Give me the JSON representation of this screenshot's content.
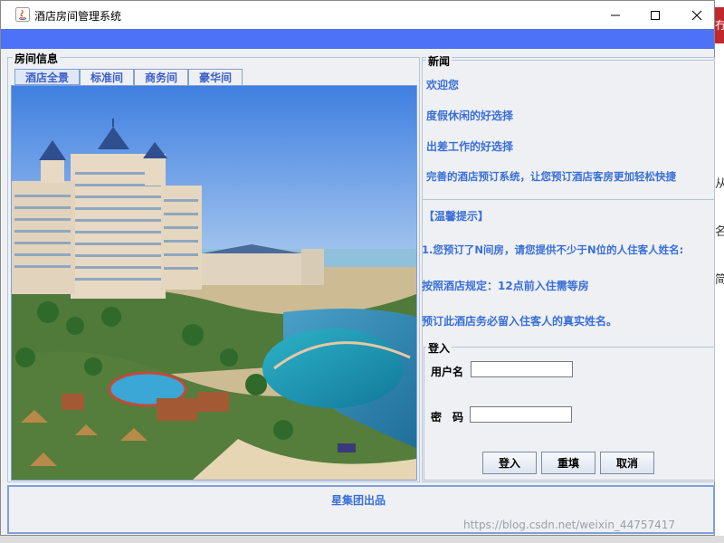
{
  "window": {
    "title": "酒店房间管理系统"
  },
  "room_panel": {
    "title": "房间信息",
    "tabs": [
      {
        "label": "酒店全景",
        "active": true
      },
      {
        "label": "标准间",
        "active": false
      },
      {
        "label": "商务间",
        "active": false
      },
      {
        "label": "豪华间",
        "active": false
      }
    ],
    "image_alt": "hotel-panorama"
  },
  "news": {
    "title": "新闻",
    "lines": [
      "欢迎您",
      "度假休闲的好选择",
      "出差工作的好选择",
      "完善的酒店预订系统，让您预订酒店客房更加轻松快捷",
      "【温馨提示】",
      "1.您预订了N间房，请您提供不少于N位的人住客人姓名:",
      "按照酒店规定：12点前入住需等房",
      "预订此酒店务必留入住客人的真实姓名。"
    ]
  },
  "login": {
    "title": "登入",
    "username_label": "用户名",
    "password_label": "密　码",
    "username_value": "",
    "password_value": "",
    "buttons": {
      "login": "登入",
      "reset": "重填",
      "cancel": "取消"
    }
  },
  "footer": {
    "text": "星集团出品"
  },
  "watermark": "https://blog.csdn.net/weixin_44757417",
  "background": {
    "right_red_text": "冇",
    "right_chars": [
      "从",
      "名",
      "简"
    ]
  },
  "colors": {
    "accent_strip": "#4d71f7",
    "link_blue": "#3a6fd8",
    "panel_bg": "#eef0f3"
  }
}
